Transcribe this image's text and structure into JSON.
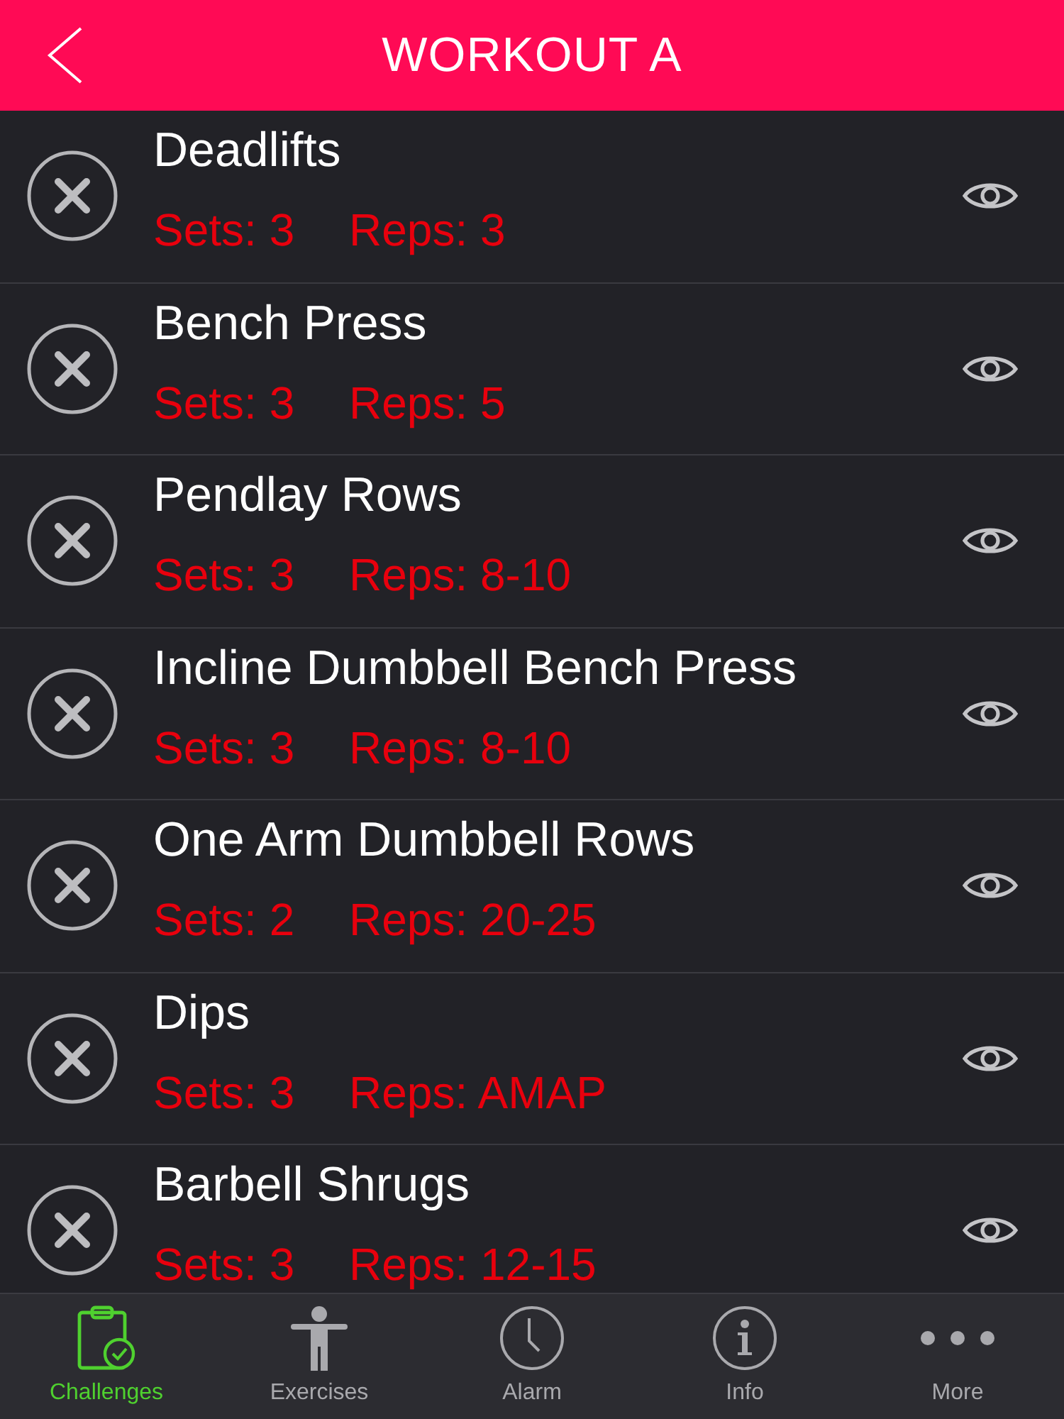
{
  "header": {
    "title": "WORKOUT A"
  },
  "exercises": [
    {
      "name": "Deadlifts",
      "sets": "Sets: 3",
      "reps": "Reps: 3"
    },
    {
      "name": "Bench Press",
      "sets": "Sets: 3",
      "reps": "Reps: 5"
    },
    {
      "name": "Pendlay Rows",
      "sets": "Sets: 3",
      "reps": "Reps: 8-10"
    },
    {
      "name": "Incline Dumbbell Bench Press",
      "sets": "Sets: 3",
      "reps": "Reps: 8-10"
    },
    {
      "name": "One Arm Dumbbell Rows",
      "sets": "Sets: 2",
      "reps": "Reps: 20-25"
    },
    {
      "name": "Dips",
      "sets": "Sets: 3",
      "reps": "Reps: AMAP"
    },
    {
      "name": "Barbell Shrugs",
      "sets": "Sets: 3",
      "reps": "Reps: 12-15"
    }
  ],
  "tab_bar": {
    "items": [
      {
        "label": "Challenges",
        "selected": true
      },
      {
        "label": "Exercises",
        "selected": false
      },
      {
        "label": "Alarm",
        "selected": false
      },
      {
        "label": "Info",
        "selected": false
      },
      {
        "label": "More",
        "selected": false
      }
    ]
  }
}
